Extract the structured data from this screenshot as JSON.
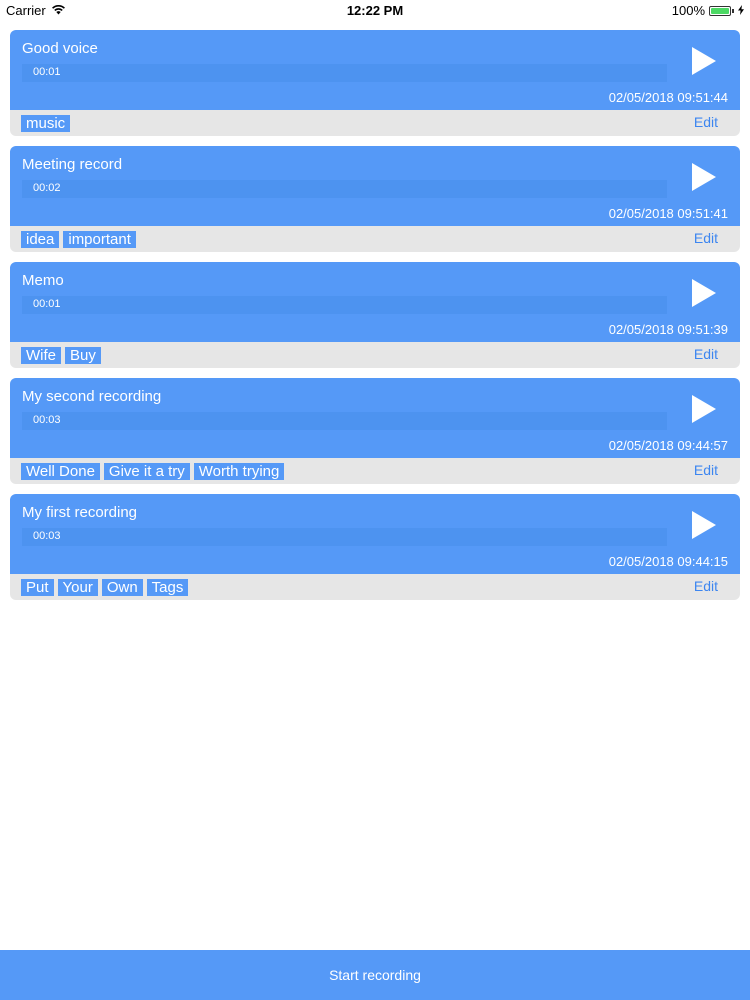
{
  "status_bar": {
    "carrier": "Carrier",
    "time": "12:22 PM",
    "battery": "100%",
    "battery_level": 1.0
  },
  "recordings": [
    {
      "title": "Good voice",
      "duration": "00:01",
      "date": "02/05/2018 09:51:44",
      "tags": [
        "music"
      ],
      "edit_label": "Edit",
      "progress": 0
    },
    {
      "title": "Meeting record",
      "duration": "00:02",
      "date": "02/05/2018 09:51:41",
      "tags": [
        "idea",
        "important"
      ],
      "edit_label": "Edit",
      "progress": 0
    },
    {
      "title": "Memo",
      "duration": "00:01",
      "date": "02/05/2018 09:51:39",
      "tags": [
        "Wife",
        "Buy"
      ],
      "edit_label": "Edit",
      "progress": 0
    },
    {
      "title": "My second recording",
      "duration": "00:03",
      "date": "02/05/2018 09:44:57",
      "tags": [
        "Well Done",
        "Give it a try",
        "Worth trying"
      ],
      "edit_label": "Edit",
      "progress": 0
    },
    {
      "title": "My first recording",
      "duration": "00:03",
      "date": "02/05/2018 09:44:15",
      "tags": [
        "Put",
        "Your",
        "Own",
        "Tags"
      ],
      "edit_label": "Edit",
      "progress": 0
    }
  ],
  "bottom_button": {
    "label": "Start recording"
  },
  "colors": {
    "card": "#5599f7",
    "tag_row": "#e6e6e6",
    "edit": "#3d86f0"
  }
}
